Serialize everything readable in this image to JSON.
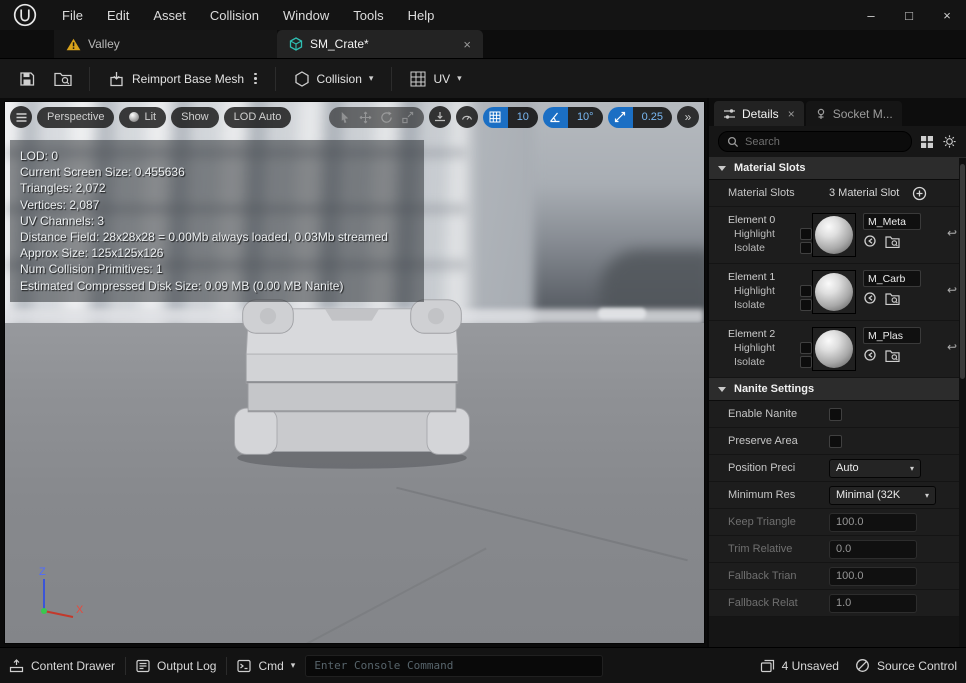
{
  "icons": {
    "chevron_down": "▾",
    "reset_arrow": "↩"
  },
  "titlebar": {
    "menu": [
      "File",
      "Edit",
      "Asset",
      "Collision",
      "Window",
      "Tools",
      "Help"
    ],
    "window_controls": {
      "minimize": "–",
      "maximize": "□",
      "close": "×"
    }
  },
  "tabbar": {
    "valley_label": "Valley",
    "active_label": "SM_Crate*",
    "close_glyph": "×"
  },
  "toolbar": {
    "reimport_label": "Reimport Base Mesh",
    "collision_label": "Collision",
    "uv_label": "UV"
  },
  "viewport": {
    "toolbar": {
      "perspective": "Perspective",
      "lit": "Lit",
      "show": "Show",
      "lod": "LOD Auto",
      "grid_snap_value": "10",
      "angle_snap_value": "10°",
      "scale_snap_value": "0.25",
      "more_glyph": "»"
    },
    "stats": [
      "LOD: 0",
      "Current Screen Size: 0.455636",
      "Triangles: 2,072",
      "Vertices: 2,087",
      "UV Channels: 3",
      "Distance Field: 28x28x28 = 0.00Mb always loaded, 0.03Mb streamed",
      "Approx Size: 125x125x126",
      "Num Collision Primitives: 1",
      "Estimated Compressed Disk Size: 0.09 MB (0.00 MB Nanite)"
    ],
    "axis": {
      "z": "Z",
      "x": "X"
    }
  },
  "details": {
    "tabs": {
      "details_label": "Details",
      "socket_label": "Socket M...",
      "close_glyph": "×"
    },
    "search": {
      "placeholder": "Search"
    },
    "material_slots": {
      "header": "Material Slots",
      "label": "Material Slots",
      "count": "3 Material Slot",
      "elements": [
        {
          "name": "Element 0",
          "highlight_label": "Highlight",
          "isolate_label": "Isolate",
          "material": "M_Meta"
        },
        {
          "name": "Element 1",
          "highlight_label": "Highlight",
          "isolate_label": "Isolate",
          "material": "M_Carb"
        },
        {
          "name": "Element 2",
          "highlight_label": "Highlight",
          "isolate_label": "Isolate",
          "material": "M_Plas"
        }
      ]
    },
    "nanite": {
      "header": "Nanite Settings",
      "rows": [
        {
          "label": "Enable Nanite"
        },
        {
          "label": "Preserve Area"
        },
        {
          "label": "Position Preci",
          "value": "Auto"
        },
        {
          "label": "Minimum Res",
          "value": "Minimal (32K"
        },
        {
          "label": "Keep Triangle",
          "value": "100.0"
        },
        {
          "label": "Trim Relative",
          "value": "0.0"
        },
        {
          "label": "Fallback Trian",
          "value": "100.0"
        },
        {
          "label": "Fallback Relat",
          "value": "1.0"
        }
      ]
    }
  },
  "statusbar": {
    "content_drawer": "Content Drawer",
    "output_log": "Output Log",
    "cmd": "Cmd",
    "console_placeholder": "Enter Console Command",
    "unsaved": "4 Unsaved",
    "source_control": "Source Control"
  }
}
